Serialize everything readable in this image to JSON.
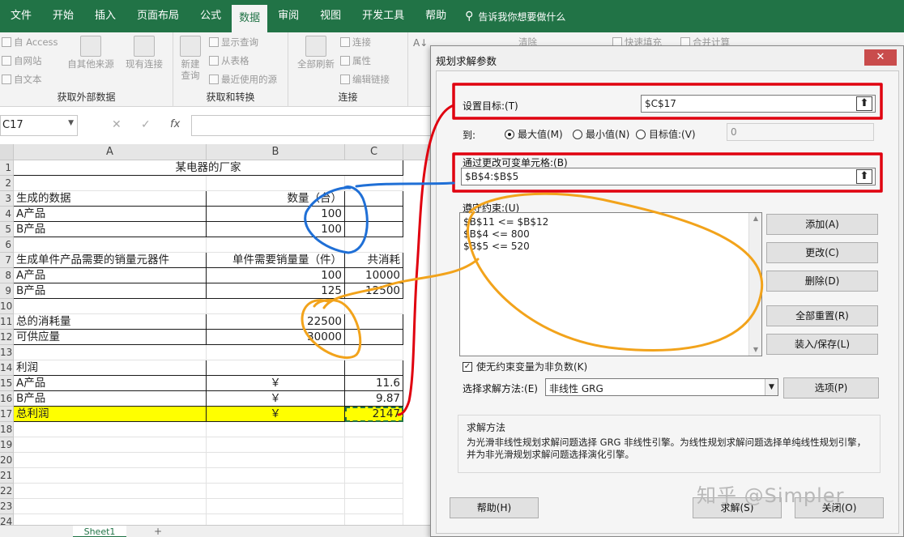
{
  "menu": {
    "tabs": [
      "文件",
      "开始",
      "插入",
      "页面布局",
      "公式",
      "数据",
      "审阅",
      "视图",
      "开发工具",
      "帮助"
    ],
    "active": "数据",
    "tellme": "告诉我你想要做什么"
  },
  "ribbon": {
    "get_external": {
      "items": [
        "自 Access",
        "自网站",
        "自文本"
      ],
      "other_sources": "自其他来源",
      "existing_conn": "现有连接",
      "label": "获取外部数据"
    },
    "get_transform": {
      "new_query": "新建\n查询",
      "items": [
        "显示查询",
        "从表格",
        "最近使用的源"
      ],
      "label": "获取和转换"
    },
    "connections": {
      "refresh_all": "全部刷新",
      "items": [
        "连接",
        "属性",
        "编辑链接"
      ],
      "label": "连接"
    },
    "partial": {
      "clear": "清除",
      "flash_fill": "快速填充",
      "merge_calc": "合并计算"
    }
  },
  "formula_bar": {
    "name_box": "C17",
    "fx": "fx"
  },
  "sheet": {
    "columns": [
      "A",
      "B",
      "C"
    ],
    "rows": [
      "1",
      "2",
      "3",
      "4",
      "5",
      "6",
      "7",
      "8",
      "9",
      "10",
      "11",
      "12",
      "13",
      "14",
      "15",
      "16",
      "17",
      "18",
      "19",
      "20",
      "21",
      "22",
      "23",
      "24"
    ],
    "title": "某电器的厂家",
    "cells": {
      "A3": "生成的数据",
      "B3": "数量（台）",
      "A4": "A产品",
      "B4": "100",
      "A5": "B产品",
      "B5": "100",
      "A7": "生成单件产品需要的销量元器件",
      "B7": "单件需要销量量（件）",
      "C7": "共消耗",
      "A8": "A产品",
      "B8": "100",
      "C8": "10000",
      "A9": "B产品",
      "B9": "125",
      "C9": "12500",
      "A11": "总的消耗量",
      "B11": "22500",
      "A12": "可供应量",
      "B12": "30000",
      "A14": "利润",
      "A15": "A产品",
      "B15": "￥",
      "C15": "11.6",
      "A16": "B产品",
      "B16": "￥",
      "C16": "9.87",
      "A17": "总利润",
      "B17": "￥",
      "C17": "2147"
    },
    "tab": "Sheet1",
    "add_sheet": "+"
  },
  "dialog": {
    "title": "规划求解参数",
    "close": "✕",
    "set_objective_label": "设置目标:(T)",
    "set_objective_value": "$C$17",
    "to_label": "到:",
    "radio_max": "最大值(M)",
    "radio_min": "最小值(N)",
    "radio_value": "目标值:(V)",
    "target_value": "0",
    "changing_cells_label": "通过更改可变单元格:(B)",
    "changing_cells_value": "$B$4:$B$5",
    "constraints_label": "遵守约束:(U)",
    "constraints": [
      "$B$11 <= $B$12",
      "$B$4 <= 800",
      "$B$5 <= 520"
    ],
    "btn_add": "添加(A)",
    "btn_change": "更改(C)",
    "btn_delete": "删除(D)",
    "btn_reset": "全部重置(R)",
    "btn_loadsave": "装入/保存(L)",
    "nonneg_label": "使无约束变量为非负数(K)",
    "method_label": "选择求解方法:(E)",
    "method_value": "非线性 GRG",
    "btn_options": "选项(P)",
    "method_box_title": "求解方法",
    "method_box_desc": "为光滑非线性规划求解问题选择 GRG 非线性引擎。为线性规划求解问题选择单纯线性规划引擎，并为非光滑规划求解问题选择演化引擎。",
    "btn_help": "帮助(H)",
    "btn_solve": "求解(S)",
    "btn_close": "关闭(O)"
  },
  "watermark": "知乎 @Simpler",
  "colors": {
    "excel_green": "#217346",
    "highlight_yellow": "#ffff00",
    "annotation_red": "#e0000f",
    "annotation_blue": "#1f6fd6",
    "annotation_orange": "#f2a31b"
  }
}
